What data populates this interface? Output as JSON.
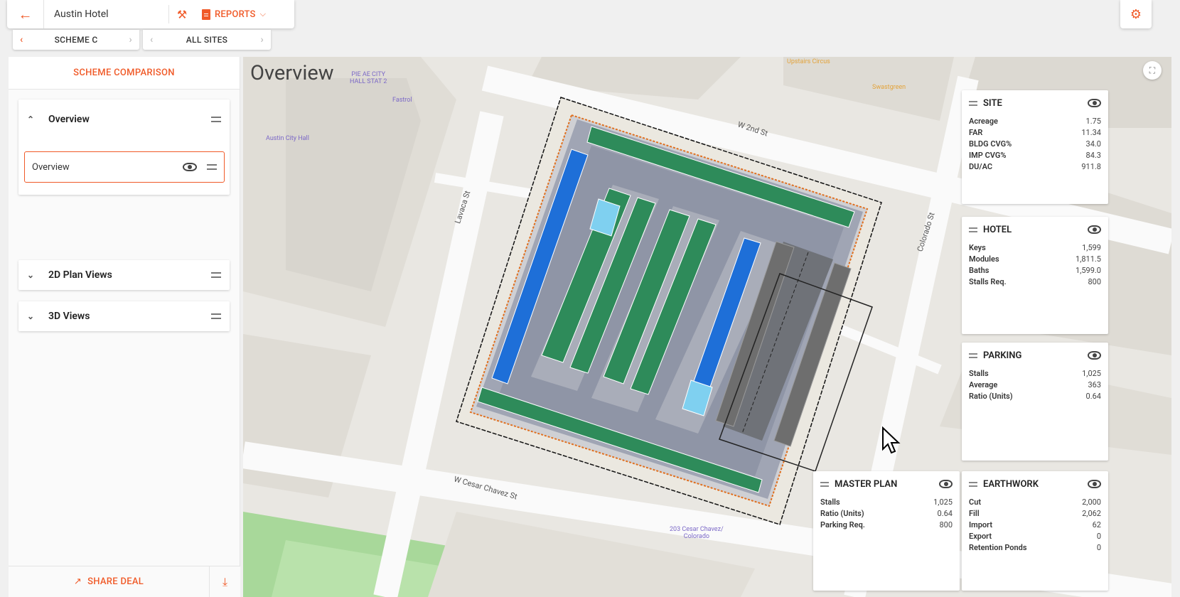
{
  "header": {
    "project_name": "Austin Hotel",
    "reports_label": "REPORTS"
  },
  "nav": {
    "scheme_label": "SCHEME C",
    "sites_label": "ALL SITES"
  },
  "left_panel": {
    "title": "SCHEME COMPARISON",
    "sections": [
      {
        "label": "Overview",
        "expanded": true,
        "items": [
          {
            "label": "Overview"
          }
        ]
      },
      {
        "label": "2D Plan Views",
        "expanded": false
      },
      {
        "label": "3D Views",
        "expanded": false
      }
    ],
    "share_label": "SHARE DEAL"
  },
  "map": {
    "title": "Overview",
    "streets": {
      "w2nd": "W 2nd St",
      "lavaca": "Lavaca St",
      "colorado": "Colorado St",
      "cesar": "W Cesar Chavez St"
    },
    "pois": {
      "pie": "PIE AE CITY\nHALL STAT 2",
      "fastrol": "Fastrol",
      "cityhall": "Austin City Hall",
      "upstairs": "Upstairs Circus",
      "swastgreen": "Swastgreen",
      "cesar203": "203 Cesar Chavez/\nColorado"
    }
  },
  "cards": {
    "site": {
      "title": "SITE",
      "rows": [
        {
          "k": "Acreage",
          "v": "1.75"
        },
        {
          "k": "FAR",
          "v": "11.34"
        },
        {
          "k": "BLDG CVG%",
          "v": "34.0"
        },
        {
          "k": "IMP CVG%",
          "v": "84.3"
        },
        {
          "k": "DU/AC",
          "v": "911.8"
        }
      ]
    },
    "hotel": {
      "title": "HOTEL",
      "rows": [
        {
          "k": "Keys",
          "v": "1,599"
        },
        {
          "k": "Modules",
          "v": "1,811.5"
        },
        {
          "k": "Baths",
          "v": "1,599.0"
        },
        {
          "k": "Stalls Req.",
          "v": "800"
        }
      ]
    },
    "parking": {
      "title": "PARKING",
      "rows": [
        {
          "k": "Stalls",
          "v": "1,025"
        },
        {
          "k": "Average",
          "v": "363"
        },
        {
          "k": "Ratio (Units)",
          "v": "0.64"
        }
      ]
    },
    "master_plan": {
      "title": "MASTER PLAN",
      "rows": [
        {
          "k": "Stalls",
          "v": "1,025"
        },
        {
          "k": "Ratio (Units)",
          "v": "0.64"
        },
        {
          "k": "Parking Req.",
          "v": "800"
        }
      ]
    },
    "earthwork": {
      "title": "EARTHWORK",
      "rows": [
        {
          "k": "Cut",
          "v": "2,000"
        },
        {
          "k": "Fill",
          "v": "2,062"
        },
        {
          "k": "Import",
          "v": "62"
        },
        {
          "k": "Export",
          "v": "0"
        },
        {
          "k": "Retention Ponds",
          "v": "0"
        }
      ]
    }
  },
  "colors": {
    "accent": "#f05a28",
    "stall_green": "#2e8b5a",
    "stall_blue": "#1e6fd8",
    "stall_cyan": "#7fd0f0",
    "drive_aisle": "#9aa0b0",
    "ramp_gray": "#6e6e6e"
  }
}
